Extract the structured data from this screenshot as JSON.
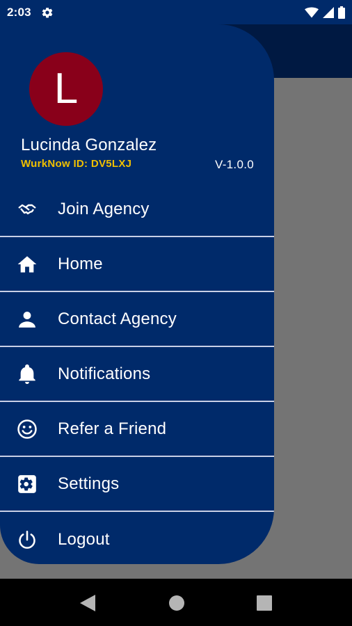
{
  "status_bar": {
    "time": "2:03",
    "icons": [
      "settings-icon",
      "wifi-icon",
      "signal-icon",
      "battery-icon"
    ]
  },
  "drawer": {
    "avatar_letter": "L",
    "avatar_color": "#89001a",
    "user_name": "Lucinda Gonzalez",
    "user_id": "WurkNow ID: DV5LXJ",
    "version": "V-1.0.0",
    "accent_color": "#002a6a",
    "id_color": "#f0c000",
    "menu": [
      {
        "label": "Join Agency",
        "icon": "handshake-icon"
      },
      {
        "label": "Home",
        "icon": "home-icon"
      },
      {
        "label": "Contact Agency",
        "icon": "person-icon"
      },
      {
        "label": "Notifications",
        "icon": "bell-icon"
      },
      {
        "label": "Refer a Friend",
        "icon": "smiley-icon"
      },
      {
        "label": "Settings",
        "icon": "gear-icon"
      },
      {
        "label": "Logout",
        "icon": "power-icon"
      }
    ]
  },
  "nav_bar": {
    "buttons": [
      "back-icon",
      "home-circle-icon",
      "recents-icon"
    ]
  }
}
